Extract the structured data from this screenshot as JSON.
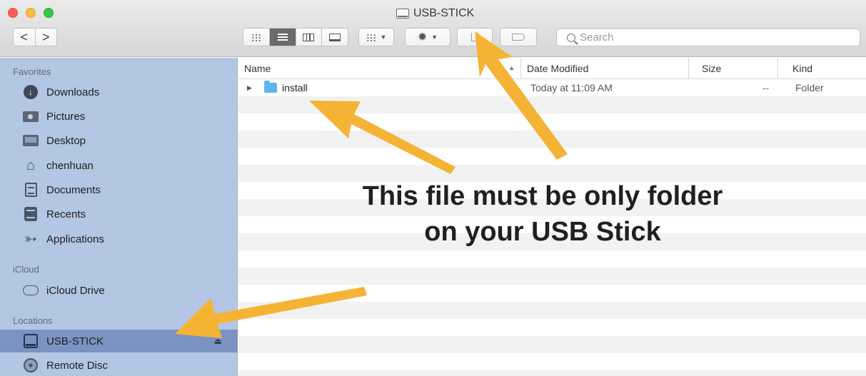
{
  "window": {
    "title": "USB-STICK",
    "nav_back": "<",
    "nav_forward": ">",
    "view_modes": [
      "icon-view",
      "list-view",
      "column-view",
      "gallery-view"
    ],
    "selected_view": "list-view",
    "search_placeholder": "Search"
  },
  "sidebar": {
    "sections": [
      {
        "label": "Favorites",
        "items": [
          {
            "label": "Downloads",
            "icon": "download-icon"
          },
          {
            "label": "Pictures",
            "icon": "camera-icon"
          },
          {
            "label": "Desktop",
            "icon": "desktop-icon"
          },
          {
            "label": "chenhuan",
            "icon": "home-icon"
          },
          {
            "label": "Documents",
            "icon": "document-icon"
          },
          {
            "label": "Recents",
            "icon": "recents-icon"
          },
          {
            "label": "Applications",
            "icon": "applications-icon"
          }
        ]
      },
      {
        "label": "iCloud",
        "items": [
          {
            "label": "iCloud Drive",
            "icon": "cloud-icon"
          }
        ]
      },
      {
        "label": "Locations",
        "items": [
          {
            "label": "USB-STICK",
            "icon": "usb-drive-icon",
            "selected": true
          },
          {
            "label": "Remote Disc",
            "icon": "disc-icon"
          }
        ]
      }
    ]
  },
  "file_list": {
    "columns": [
      "Name",
      "Date Modified",
      "Size",
      "Kind"
    ],
    "sort_column": "Name",
    "rows": [
      {
        "name": "install",
        "date_modified": "Today at 11:09 AM",
        "size": "--",
        "kind": "Folder"
      }
    ]
  },
  "annotation": {
    "line1": "This file must be only folder",
    "line2": "on your USB Stick",
    "arrow_color": "#f5b335"
  },
  "colors": {
    "sidebar_bg": "#b3c6e3",
    "sidebar_selected": "#7b93c2",
    "folder_blue": "#5fb4ef"
  }
}
